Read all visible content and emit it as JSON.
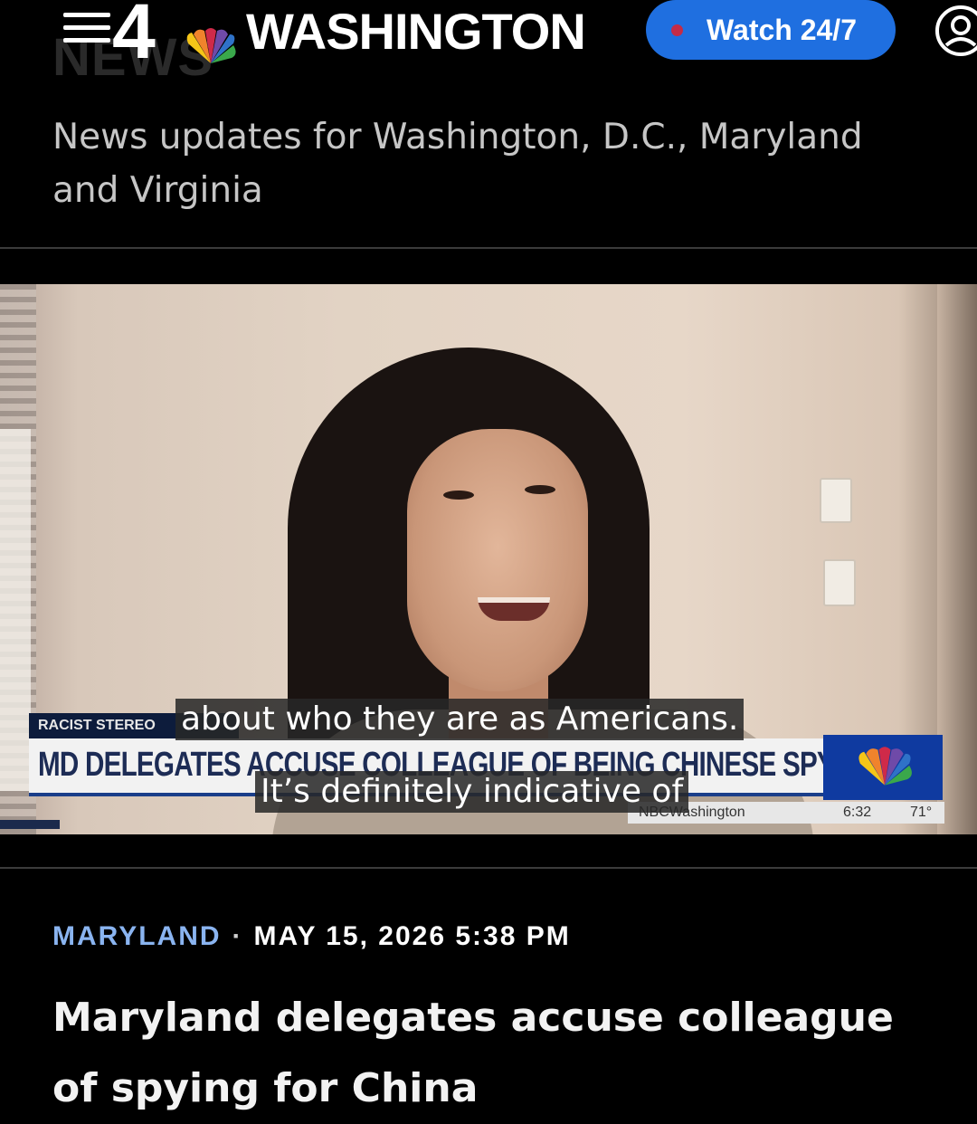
{
  "header": {
    "brand_number": "4",
    "brand_name": "WASHINGTON",
    "ghost_text": "NEWS",
    "watch_label": "Watch 24/7",
    "icons": {
      "menu": "hamburger-menu-icon",
      "peacock": "nbc-peacock-icon",
      "live": "live-dot-icon",
      "account": "account-icon"
    },
    "colors": {
      "watch_button": "#1f6fe0",
      "live_dot": "#c42b47"
    }
  },
  "tagline": "News updates for Washington, D.C., Maryland and Virginia",
  "video": {
    "lower_third": {
      "tag": "RACIST STEREO",
      "headline": "MD DELEGATES ACCUSE COLLEAGUE OF BEING CHINESE SPY",
      "ticker_brand": "NBCWashington",
      "ticker_time": "6:32",
      "ticker_temp": "71°"
    },
    "captions": [
      "about who they are as Americans.",
      "It’s definitely indicative of"
    ]
  },
  "article": {
    "category": "MARYLAND",
    "separator": "·",
    "date": "MAY 15, 2026 5:38 PM",
    "headline": "Maryland delegates accuse colleague of spying for China",
    "colors": {
      "category": "#8ab4f0"
    }
  }
}
